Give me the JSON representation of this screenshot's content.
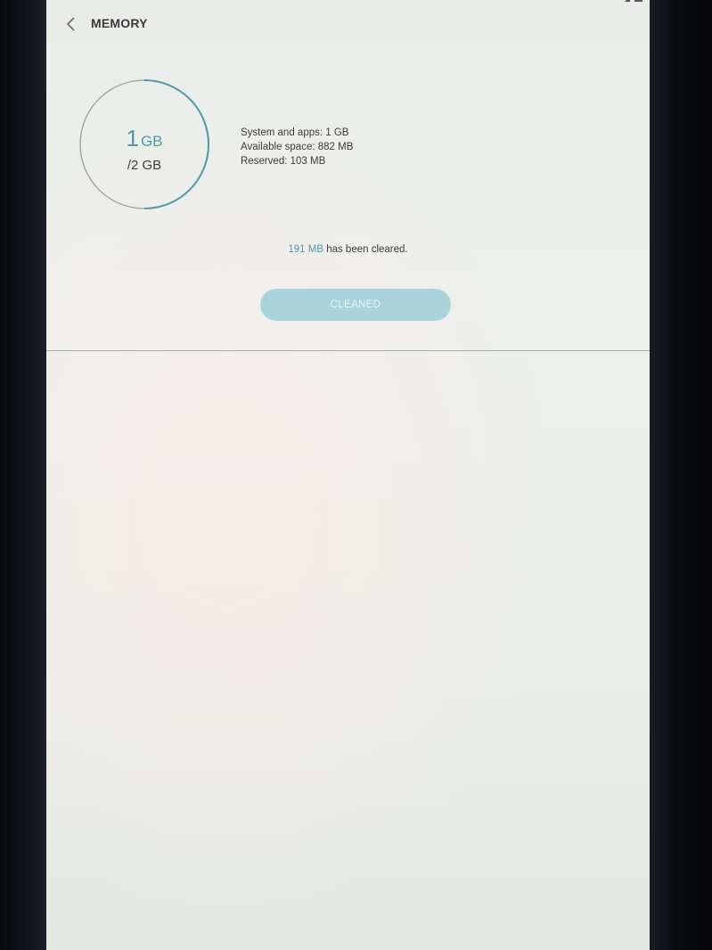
{
  "header": {
    "back_icon": "chevron-left-icon",
    "title": "MEMORY"
  },
  "gauge": {
    "used_value": "1",
    "used_unit": "GB",
    "total": "/2 GB",
    "used_fraction": 0.5,
    "colors": {
      "used_arc": "#4f9aa6",
      "track": "#9aa09c"
    }
  },
  "details": {
    "system_apps": "System and apps: 1 GB",
    "available": "Available space: 882 MB",
    "reserved": "Reserved: 103 MB"
  },
  "cleared": {
    "amount": "191 MB",
    "text": " has been cleared."
  },
  "clean_button": {
    "label": "CLEANED"
  },
  "colors": {
    "accent": "#4f9aa6",
    "button_bg": "#aad4da"
  }
}
